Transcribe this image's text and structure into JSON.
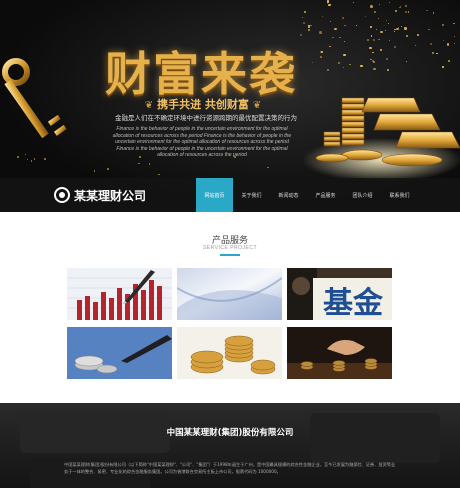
{
  "hero": {
    "title": "财富来袭",
    "slogan": "携手共进 共创财富",
    "tagline": "金融是人们在不确定环境中进行资源跨期的最优配置决策的行为",
    "english": "Finance is the behavior of people in the uncertain environment for the optimal allocation of resources across the period Finance is the behavior of people in the uncertain environment for the optimal allocation of resources across the period Finance is the behavior of people in the uncertain environment for the optimal allocation of resources across the period"
  },
  "logo": {
    "text": "某某理财公司",
    "icon": "logo-mark-icon"
  },
  "nav": {
    "items": [
      {
        "label": "网站首页",
        "active": true
      },
      {
        "label": "关于我们",
        "active": false
      },
      {
        "label": "新闻动态",
        "active": false
      },
      {
        "label": "产品服务",
        "active": false
      },
      {
        "label": "团队介绍",
        "active": false
      },
      {
        "label": "联系我们",
        "active": false
      }
    ]
  },
  "section": {
    "title": "产品服务",
    "subtitle": "SERVICE PROJECT"
  },
  "products": [
    {
      "name": "bar-chart-pen-image"
    },
    {
      "name": "abstract-blue-image"
    },
    {
      "name": "fund-sign-image"
    },
    {
      "name": "coins-pen-image"
    },
    {
      "name": "gold-coins-image"
    },
    {
      "name": "hand-coins-image"
    }
  ],
  "footer": {
    "company": "中国某某理财(集团)股份有限公司",
    "description": "中国某某理财(集团)股份有限公司（以下简称\"中国某某理财\"、\"公司\"、\"集团\"）于1998年诞生于广州，是中国最具规模的综合性金融企业，至今已发展为融保险、证券、投资等业务于一体的整合、紧密、专业化的综合金融服务集团。公司为香港联合交易所主板上市公司，股票代码为 1000000。"
  },
  "colors": {
    "accent": "#2aa8c7",
    "gold": "#e6b04a",
    "footer_bg": "#1e1e1e"
  }
}
